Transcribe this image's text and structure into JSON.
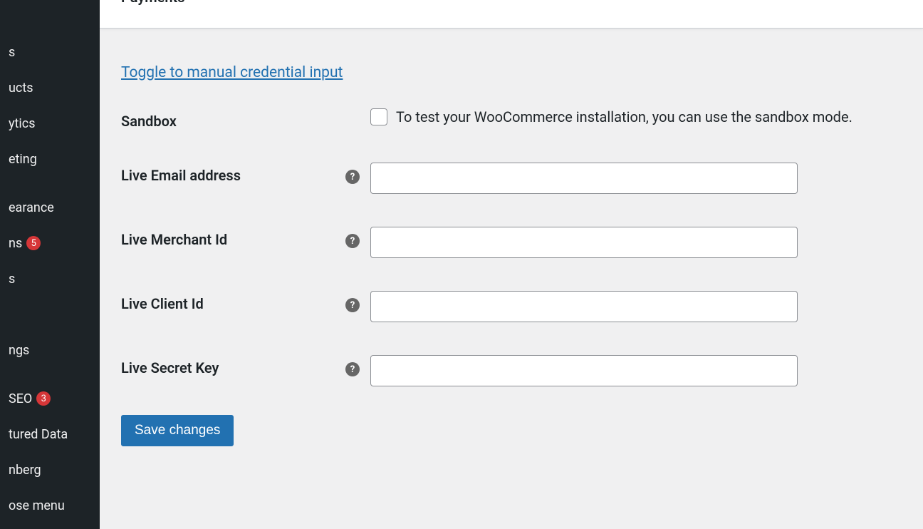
{
  "sidebar": {
    "items": [
      {
        "label": "s"
      },
      {
        "label": "ucts"
      },
      {
        "label": "ytics"
      },
      {
        "label": "eting"
      },
      {
        "label": "earance"
      },
      {
        "label": "ns",
        "badge": "5"
      },
      {
        "label": "s"
      },
      {
        "label": " "
      },
      {
        "label": "ngs"
      },
      {
        "label": " SEO",
        "badge": "3"
      },
      {
        "label": "tured Data"
      },
      {
        "label": "nberg"
      },
      {
        "label": "ose menu"
      }
    ]
  },
  "header": {
    "tab": "Payments"
  },
  "form": {
    "toggle_link": "Toggle to manual credential input",
    "sandbox": {
      "label": "Sandbox",
      "description": "To test your WooCommerce installation, you can use the sandbox mode."
    },
    "live_email": {
      "label": "Live Email address",
      "value": ""
    },
    "live_merchant": {
      "label": "Live Merchant Id",
      "value": ""
    },
    "live_client": {
      "label": "Live Client Id",
      "value": ""
    },
    "live_secret": {
      "label": "Live Secret Key",
      "value": ""
    },
    "save_button": "Save changes"
  }
}
